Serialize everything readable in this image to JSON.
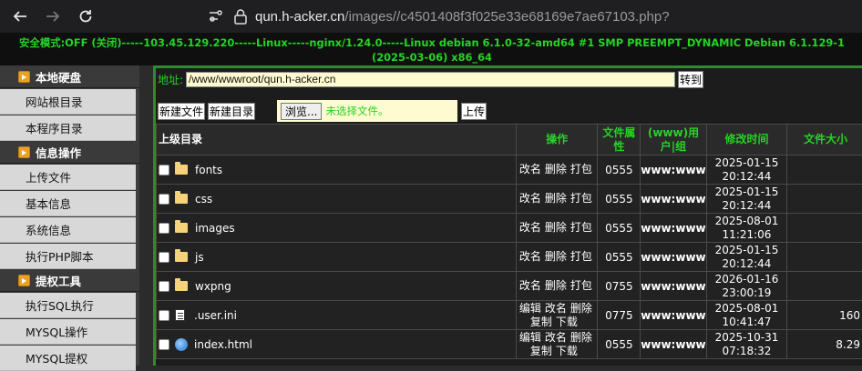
{
  "browser": {
    "url_host": "qun.h-acker.cn",
    "url_path": "/images//c4501408f3f025e33e68169e7ae67103.php?"
  },
  "status_line": "安全模式:OFF (关闭)-----103.45.129.220-----Linux-----nginx/1.24.0-----Linux debian 6.1.0-32-amd64 #1 SMP PREEMPT_DYNAMIC Debian 6.1.129-1 (2025-03-06) x86_64",
  "sidebar": {
    "sections": [
      {
        "title": "本地硬盘",
        "items": [
          "网站根目录",
          "本程序目录"
        ]
      },
      {
        "title": "信息操作",
        "items": [
          "上传文件",
          "基本信息",
          "系统信息",
          "执行PHP脚本"
        ]
      },
      {
        "title": "提权工具",
        "items": [
          "执行SQL执行",
          "MYSQL操作",
          "MYSQL提权"
        ]
      }
    ]
  },
  "toolbar": {
    "address_label": "地址:",
    "address_value": "/www/wwwroot/qun.h-acker.cn",
    "goto": "转到",
    "new_file": "新建文件",
    "new_dir": "新建目录",
    "browse": "浏览...",
    "no_file": "未选择文件。",
    "upload": "上传"
  },
  "table": {
    "headers": [
      "上级目录",
      "操作",
      "文件属性",
      "(www)用户|组",
      "修改时间",
      "文件大小"
    ],
    "rows": [
      {
        "name": "fonts",
        "type": "folder",
        "ops": [
          "改名",
          "删除",
          "打包"
        ],
        "perm": "0555",
        "owner": "www:www",
        "time": "2025-01-15 20:12:44",
        "size": ""
      },
      {
        "name": "css",
        "type": "folder",
        "ops": [
          "改名",
          "删除",
          "打包"
        ],
        "perm": "0555",
        "owner": "www:www",
        "time": "2025-01-15 20:12:44",
        "size": ""
      },
      {
        "name": "images",
        "type": "folder",
        "ops": [
          "改名",
          "删除",
          "打包"
        ],
        "perm": "0555",
        "owner": "www:www",
        "time": "2025-08-01 11:21:06",
        "size": ""
      },
      {
        "name": "js",
        "type": "folder",
        "ops": [
          "改名",
          "删除",
          "打包"
        ],
        "perm": "0555",
        "owner": "www:www",
        "time": "2025-01-15 20:12:44",
        "size": ""
      },
      {
        "name": "wxpng",
        "type": "folder",
        "ops": [
          "改名",
          "删除",
          "打包"
        ],
        "perm": "0755",
        "owner": "www:www",
        "time": "2026-01-16 23:00:19",
        "size": ""
      },
      {
        "name": ".user.ini",
        "type": "ini",
        "ops": [
          "编辑",
          "改名",
          "删除",
          "复制",
          "下载"
        ],
        "perm": "0775",
        "owner": "www:www",
        "time": "2025-08-01 10:41:47",
        "size": "160"
      },
      {
        "name": "index.html",
        "type": "html",
        "ops": [
          "编辑",
          "改名",
          "删除",
          "复制",
          "下载"
        ],
        "perm": "0555",
        "owner": "www:www",
        "time": "2025-10-31 07:18:32",
        "size": "8.29"
      }
    ]
  }
}
